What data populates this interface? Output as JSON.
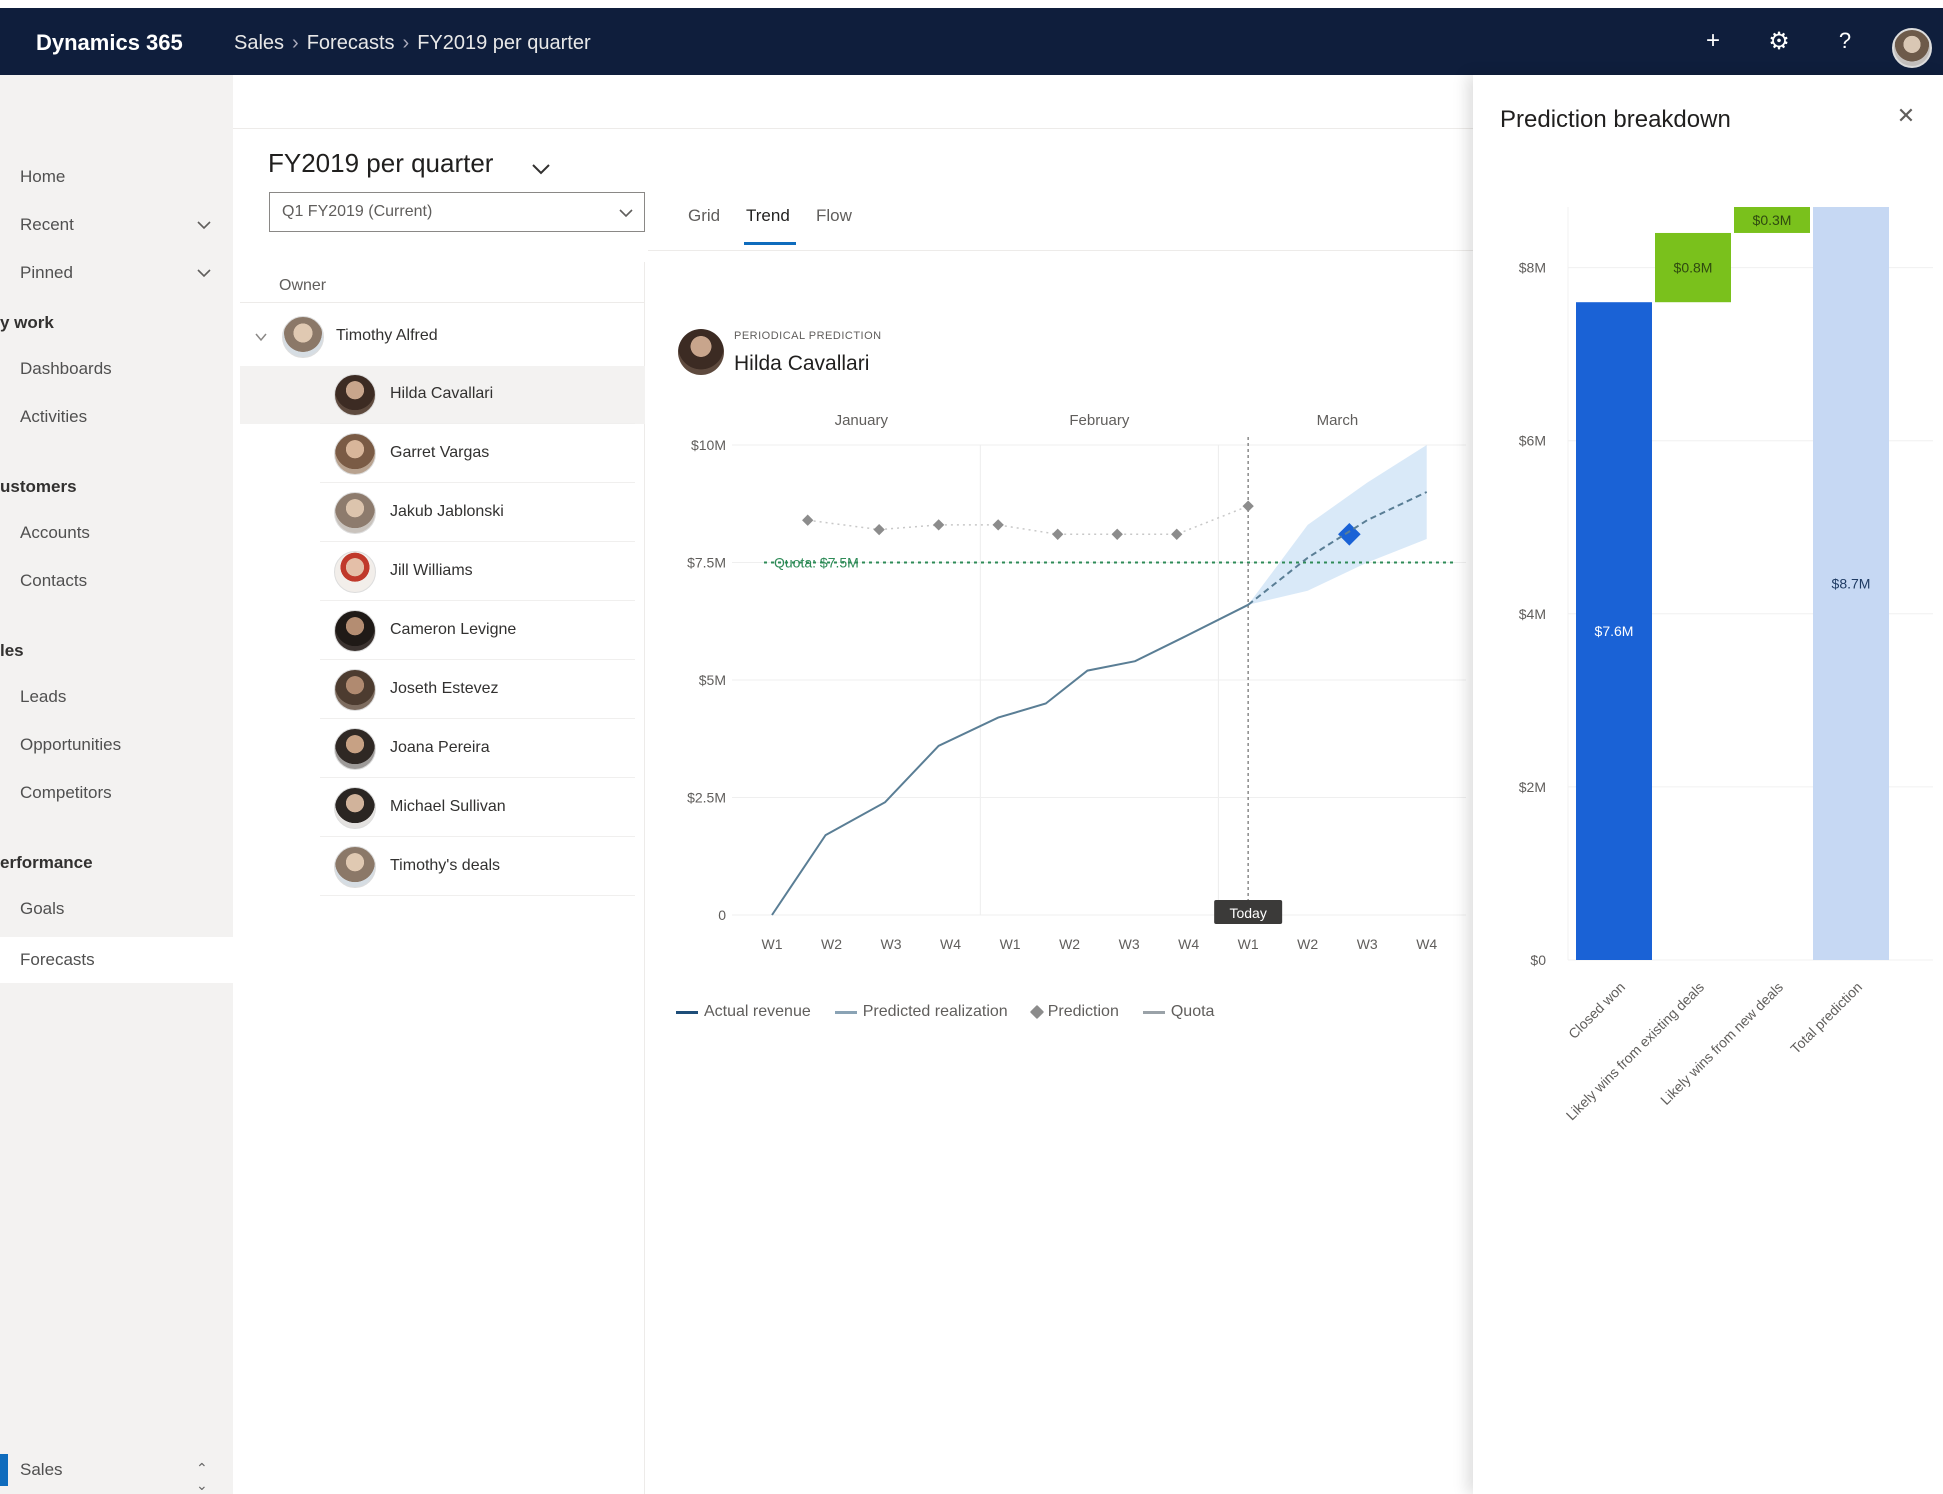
{
  "app": {
    "name": "Dynamics 365"
  },
  "breadcrumb": [
    "Sales",
    "Forecasts",
    "FY2019 per quarter"
  ],
  "topbar_icons": [
    "plus-icon",
    "gear-icon",
    "help-icon"
  ],
  "nav": {
    "items": [
      {
        "label": "Home"
      },
      {
        "label": "Recent"
      },
      {
        "label": "Pinned"
      }
    ],
    "groups": [
      {
        "label": "y work",
        "items": [
          "Dashboards",
          "Activities"
        ]
      },
      {
        "label": "ustomers",
        "items": [
          "Accounts",
          "Contacts"
        ]
      },
      {
        "label": "les",
        "items": [
          "Leads",
          "Opportunities",
          "Competitors"
        ]
      },
      {
        "label": "erformance",
        "items": [
          "Goals",
          "Forecasts"
        ]
      }
    ],
    "selected": "Forecasts",
    "area": "Sales"
  },
  "forecast": {
    "title": "FY2019 per quarter",
    "period": "Q1 FY2019 (Current)",
    "tabs": [
      "Grid",
      "Trend",
      "Flow"
    ],
    "active_tab": "Trend"
  },
  "owners": {
    "header": "Owner",
    "parent": "Timothy Alfred",
    "rows": [
      {
        "name": "Hilda Cavallari",
        "selected": true
      },
      {
        "name": "Garret Vargas"
      },
      {
        "name": "Jakub Jablonski"
      },
      {
        "name": "Jill Williams"
      },
      {
        "name": "Cameron Levigne"
      },
      {
        "name": "Joseth Estevez"
      },
      {
        "name": "Joana Pereira"
      },
      {
        "name": "Michael Sullivan"
      },
      {
        "name": "Timothy's deals"
      }
    ]
  },
  "prediction": {
    "caption": "PERIODICAL PREDICTION",
    "owner": "Hilda Cavallari"
  },
  "chart_data": [
    {
      "type": "line",
      "months": [
        "January",
        "February",
        "March"
      ],
      "x": [
        "W1",
        "W2",
        "W3",
        "W4",
        "W1",
        "W2",
        "W3",
        "W4",
        "W1",
        "W2",
        "W3",
        "W4"
      ],
      "ytick_labels": [
        "$10M",
        "$7.5M",
        "$5M",
        "$2.5M",
        "0"
      ],
      "ylim": [
        0,
        10
      ],
      "today_label": "Today",
      "today_week_index": 8,
      "quota": 7.5,
      "quota_label": "Quota: $7.5M",
      "series": [
        {
          "name": "Actual revenue",
          "color": "#5a7e95",
          "points": [
            [
              0,
              0
            ],
            [
              0.9,
              1.7
            ],
            [
              1.9,
              2.4
            ],
            [
              2.8,
              3.6
            ],
            [
              3.8,
              4.2
            ],
            [
              4.6,
              4.5
            ],
            [
              5.3,
              5.2
            ],
            [
              6.1,
              5.4
            ],
            [
              6.9,
              5.9
            ],
            [
              8.0,
              6.6
            ]
          ]
        },
        {
          "name": "Predicted realization",
          "color": "#5a7e95",
          "points": [
            [
              8.0,
              6.6
            ],
            [
              9.0,
              7.6
            ],
            [
              10.0,
              8.4
            ],
            [
              11.0,
              9.0
            ]
          ]
        },
        {
          "name": "Prediction",
          "color": "#8c8c8c",
          "points": [
            [
              0.6,
              8.4
            ],
            [
              1.8,
              8.2
            ],
            [
              2.8,
              8.3
            ],
            [
              3.8,
              8.3
            ],
            [
              4.8,
              8.1
            ],
            [
              5.8,
              8.1
            ],
            [
              6.8,
              8.1
            ],
            [
              8.0,
              8.7
            ]
          ],
          "highlight": [
            9.7,
            8.1
          ]
        },
        {
          "name": "Quota",
          "color": "#2e8b57"
        }
      ],
      "band": {
        "lower": [
          [
            8.0,
            6.6
          ],
          [
            9.0,
            6.9
          ],
          [
            10.0,
            7.5
          ],
          [
            11.0,
            8.0
          ]
        ],
        "upper": [
          [
            8.0,
            6.6
          ],
          [
            9.0,
            8.3
          ],
          [
            10.0,
            9.2
          ],
          [
            11.0,
            10.0
          ]
        ],
        "color": "#cfe3f6"
      },
      "legend": [
        "Actual revenue",
        "Predicted realization",
        "Prediction",
        "Quota"
      ]
    },
    {
      "type": "bar",
      "title": "Prediction breakdown",
      "subtype": "waterfall",
      "categories": [
        "Closed won",
        "Likely wins from existing deals",
        "Likely wins from new deals",
        "Total prediction"
      ],
      "values": [
        7.6,
        0.8,
        0.3,
        8.7
      ],
      "value_labels": [
        "$7.6M",
        "$0.8M",
        "$0.3M",
        "$8.7M"
      ],
      "ytick_labels": [
        "$8M",
        "$6M",
        "$4M",
        "$2M",
        "$0"
      ],
      "ylim": [
        0,
        8.7
      ],
      "colors": [
        "#1a62d6",
        "#7ac11c",
        "#7ac11c",
        "#c6d8f3"
      ]
    }
  ]
}
